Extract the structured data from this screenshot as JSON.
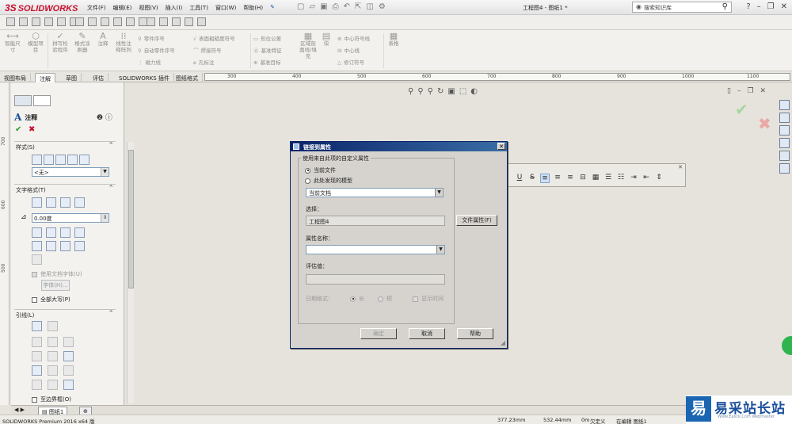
{
  "app": {
    "logo_prefix": "3S",
    "logo_text": "SOLIDWORKS",
    "menu": [
      "文件(F)",
      "编辑(E)",
      "视图(V)",
      "插入(I)",
      "工具(T)",
      "窗口(W)",
      "帮助(H)"
    ],
    "doc_title": "工程图4 - 图纸1 *",
    "search_placeholder": "搜索知识库",
    "help_label": "?"
  },
  "ribbon": {
    "smart_dimension": "智能尺\n寸",
    "model_items": "模型项\n目",
    "spell_check": "拼写检\n验程序",
    "format_painter": "格式涂\n刷器",
    "note": "注释",
    "linear_note": "线性注\n释阵列",
    "balloon": "零件序号",
    "auto_balloon": "自动零件序号",
    "magnetic_line": "磁力线",
    "surface_finish": "表面粗糙度符号",
    "weld_symbol": "焊接符号",
    "hole_callout": "孔标注",
    "gdt": "形位公差",
    "datum_feature": "基准特征",
    "datum_target": "基准目标",
    "area_hatch": "区域剖\n面线/填\n充",
    "block": "块",
    "center_mark": "中心符号线",
    "centerline": "中心线",
    "revision_symbol": "修订符号",
    "table": "表格"
  },
  "tabs": [
    "视图布局",
    "注解",
    "草图",
    "评估",
    "SOLIDWORKS 插件",
    "图纸格式"
  ],
  "active_tab": "注解",
  "ruler_marks": [
    "300",
    "400",
    "500",
    "600",
    "700",
    "800",
    "900",
    "1000",
    "1100"
  ],
  "vruler_marks": [
    "700",
    "600",
    "500"
  ],
  "property_manager": {
    "title": "注释",
    "groups": {
      "style": "样式(S)",
      "text_format": "文字格式(T)",
      "leader": "引线(L)"
    },
    "style_select": "<无>",
    "angle_value": "0.00度",
    "use_doc_font": "使用文档字体(U)",
    "font_button": "字体(H)...",
    "all_caps": "全部大写(P)",
    "to_border": "至边界框(O)"
  },
  "sheet_tab": "图纸1",
  "status": {
    "edition": "SOLIDWORKS Premium 2016 x64 版",
    "x": "377.23mm",
    "y": "532.44mm",
    "z": "0m",
    "state": "欠定义",
    "editing": "在编辑 图纸1"
  },
  "dialog": {
    "title": "链接到属性",
    "group_label": "使用来自此项的自定义属性",
    "radio_current_file": "当前文件",
    "radio_model": "此处发现的模型",
    "source_select": "当前文档",
    "selection_label": "选择：",
    "selection_value": "工程图4",
    "file_props_button": "文件属性(F)",
    "property_name_label": "属性名称：",
    "property_name_value": "",
    "evaluated_label": "评估值：",
    "evaluated_value": "",
    "date_format_label": "日期格式：",
    "date_long": "长",
    "date_short": "短",
    "show_time": "显示时间",
    "ok": "确定",
    "cancel": "取消",
    "help": "帮助"
  },
  "watermark": {
    "text": "易采站长站",
    "sub": "Www.Easck.Com Webmaster"
  }
}
